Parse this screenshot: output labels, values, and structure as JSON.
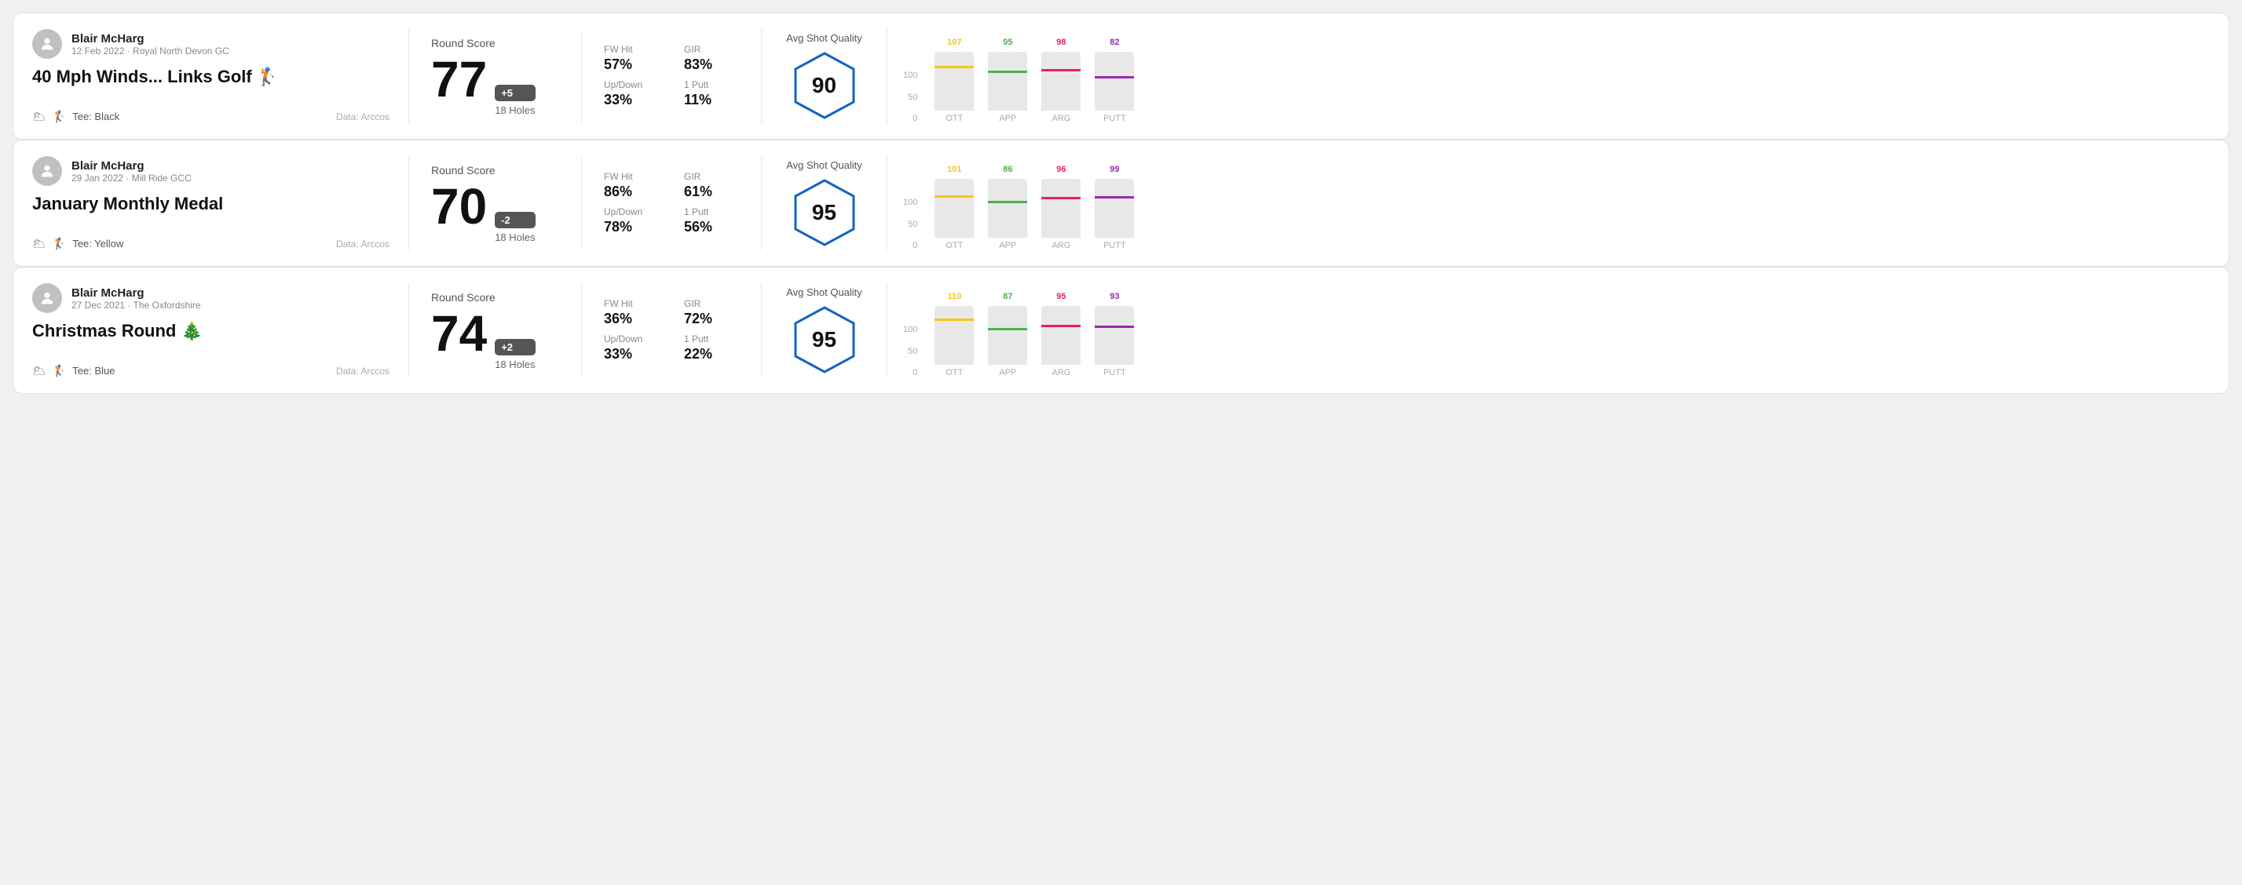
{
  "rounds": [
    {
      "id": "round-1",
      "user": {
        "name": "Blair McHarg",
        "meta": "12 Feb 2022 · Royal North Devon GC"
      },
      "title": "40 Mph Winds... Links Golf 🏌️",
      "tee": "Black",
      "data_source": "Data: Arccos",
      "score": {
        "label": "Round Score",
        "number": "77",
        "badge": "+5",
        "badge_type": "positive",
        "holes": "18 Holes"
      },
      "stats": {
        "fw_hit_label": "FW Hit",
        "fw_hit_value": "57%",
        "gir_label": "GIR",
        "gir_value": "83%",
        "updown_label": "Up/Down",
        "updown_value": "33%",
        "oneputt_label": "1 Putt",
        "oneputt_value": "11%"
      },
      "quality": {
        "label": "Avg Shot Quality",
        "value": "90"
      },
      "chart": {
        "bars": [
          {
            "category": "OTT",
            "value": 107,
            "color": "#f5c518",
            "bar_pct": 72
          },
          {
            "category": "APP",
            "value": 95,
            "color": "#4caf50",
            "bar_pct": 64
          },
          {
            "category": "ARG",
            "value": 98,
            "color": "#e91e63",
            "bar_pct": 66
          },
          {
            "category": "PUTT",
            "value": 82,
            "color": "#9c27b0",
            "bar_pct": 55
          }
        ],
        "y_labels": [
          "100",
          "50",
          "0"
        ]
      }
    },
    {
      "id": "round-2",
      "user": {
        "name": "Blair McHarg",
        "meta": "29 Jan 2022 · Mill Ride GCC"
      },
      "title": "January Monthly Medal",
      "tee": "Yellow",
      "data_source": "Data: Arccos",
      "score": {
        "label": "Round Score",
        "number": "70",
        "badge": "-2",
        "badge_type": "negative",
        "holes": "18 Holes"
      },
      "stats": {
        "fw_hit_label": "FW Hit",
        "fw_hit_value": "86%",
        "gir_label": "GIR",
        "gir_value": "61%",
        "updown_label": "Up/Down",
        "updown_value": "78%",
        "oneputt_label": "1 Putt",
        "oneputt_value": "56%"
      },
      "quality": {
        "label": "Avg Shot Quality",
        "value": "95"
      },
      "chart": {
        "bars": [
          {
            "category": "OTT",
            "value": 101,
            "color": "#f5c518",
            "bar_pct": 68
          },
          {
            "category": "APP",
            "value": 86,
            "color": "#4caf50",
            "bar_pct": 58
          },
          {
            "category": "ARG",
            "value": 96,
            "color": "#e91e63",
            "bar_pct": 65
          },
          {
            "category": "PUTT",
            "value": 99,
            "color": "#9c27b0",
            "bar_pct": 67
          }
        ],
        "y_labels": [
          "100",
          "50",
          "0"
        ]
      }
    },
    {
      "id": "round-3",
      "user": {
        "name": "Blair McHarg",
        "meta": "27 Dec 2021 · The Oxfordshire"
      },
      "title": "Christmas Round 🎄",
      "tee": "Blue",
      "data_source": "Data: Arccos",
      "score": {
        "label": "Round Score",
        "number": "74",
        "badge": "+2",
        "badge_type": "positive",
        "holes": "18 Holes"
      },
      "stats": {
        "fw_hit_label": "FW Hit",
        "fw_hit_value": "36%",
        "gir_label": "GIR",
        "gir_value": "72%",
        "updown_label": "Up/Down",
        "updown_value": "33%",
        "oneputt_label": "1 Putt",
        "oneputt_value": "22%"
      },
      "quality": {
        "label": "Avg Shot Quality",
        "value": "95"
      },
      "chart": {
        "bars": [
          {
            "category": "OTT",
            "value": 110,
            "color": "#f5c518",
            "bar_pct": 74
          },
          {
            "category": "APP",
            "value": 87,
            "color": "#4caf50",
            "bar_pct": 59
          },
          {
            "category": "ARG",
            "value": 95,
            "color": "#e91e63",
            "bar_pct": 64
          },
          {
            "category": "PUTT",
            "value": 93,
            "color": "#9c27b0",
            "bar_pct": 63
          }
        ],
        "y_labels": [
          "100",
          "50",
          "0"
        ]
      }
    }
  ],
  "labels": {
    "tee_prefix": "Tee:",
    "data_arccos": "Data: Arccos"
  }
}
